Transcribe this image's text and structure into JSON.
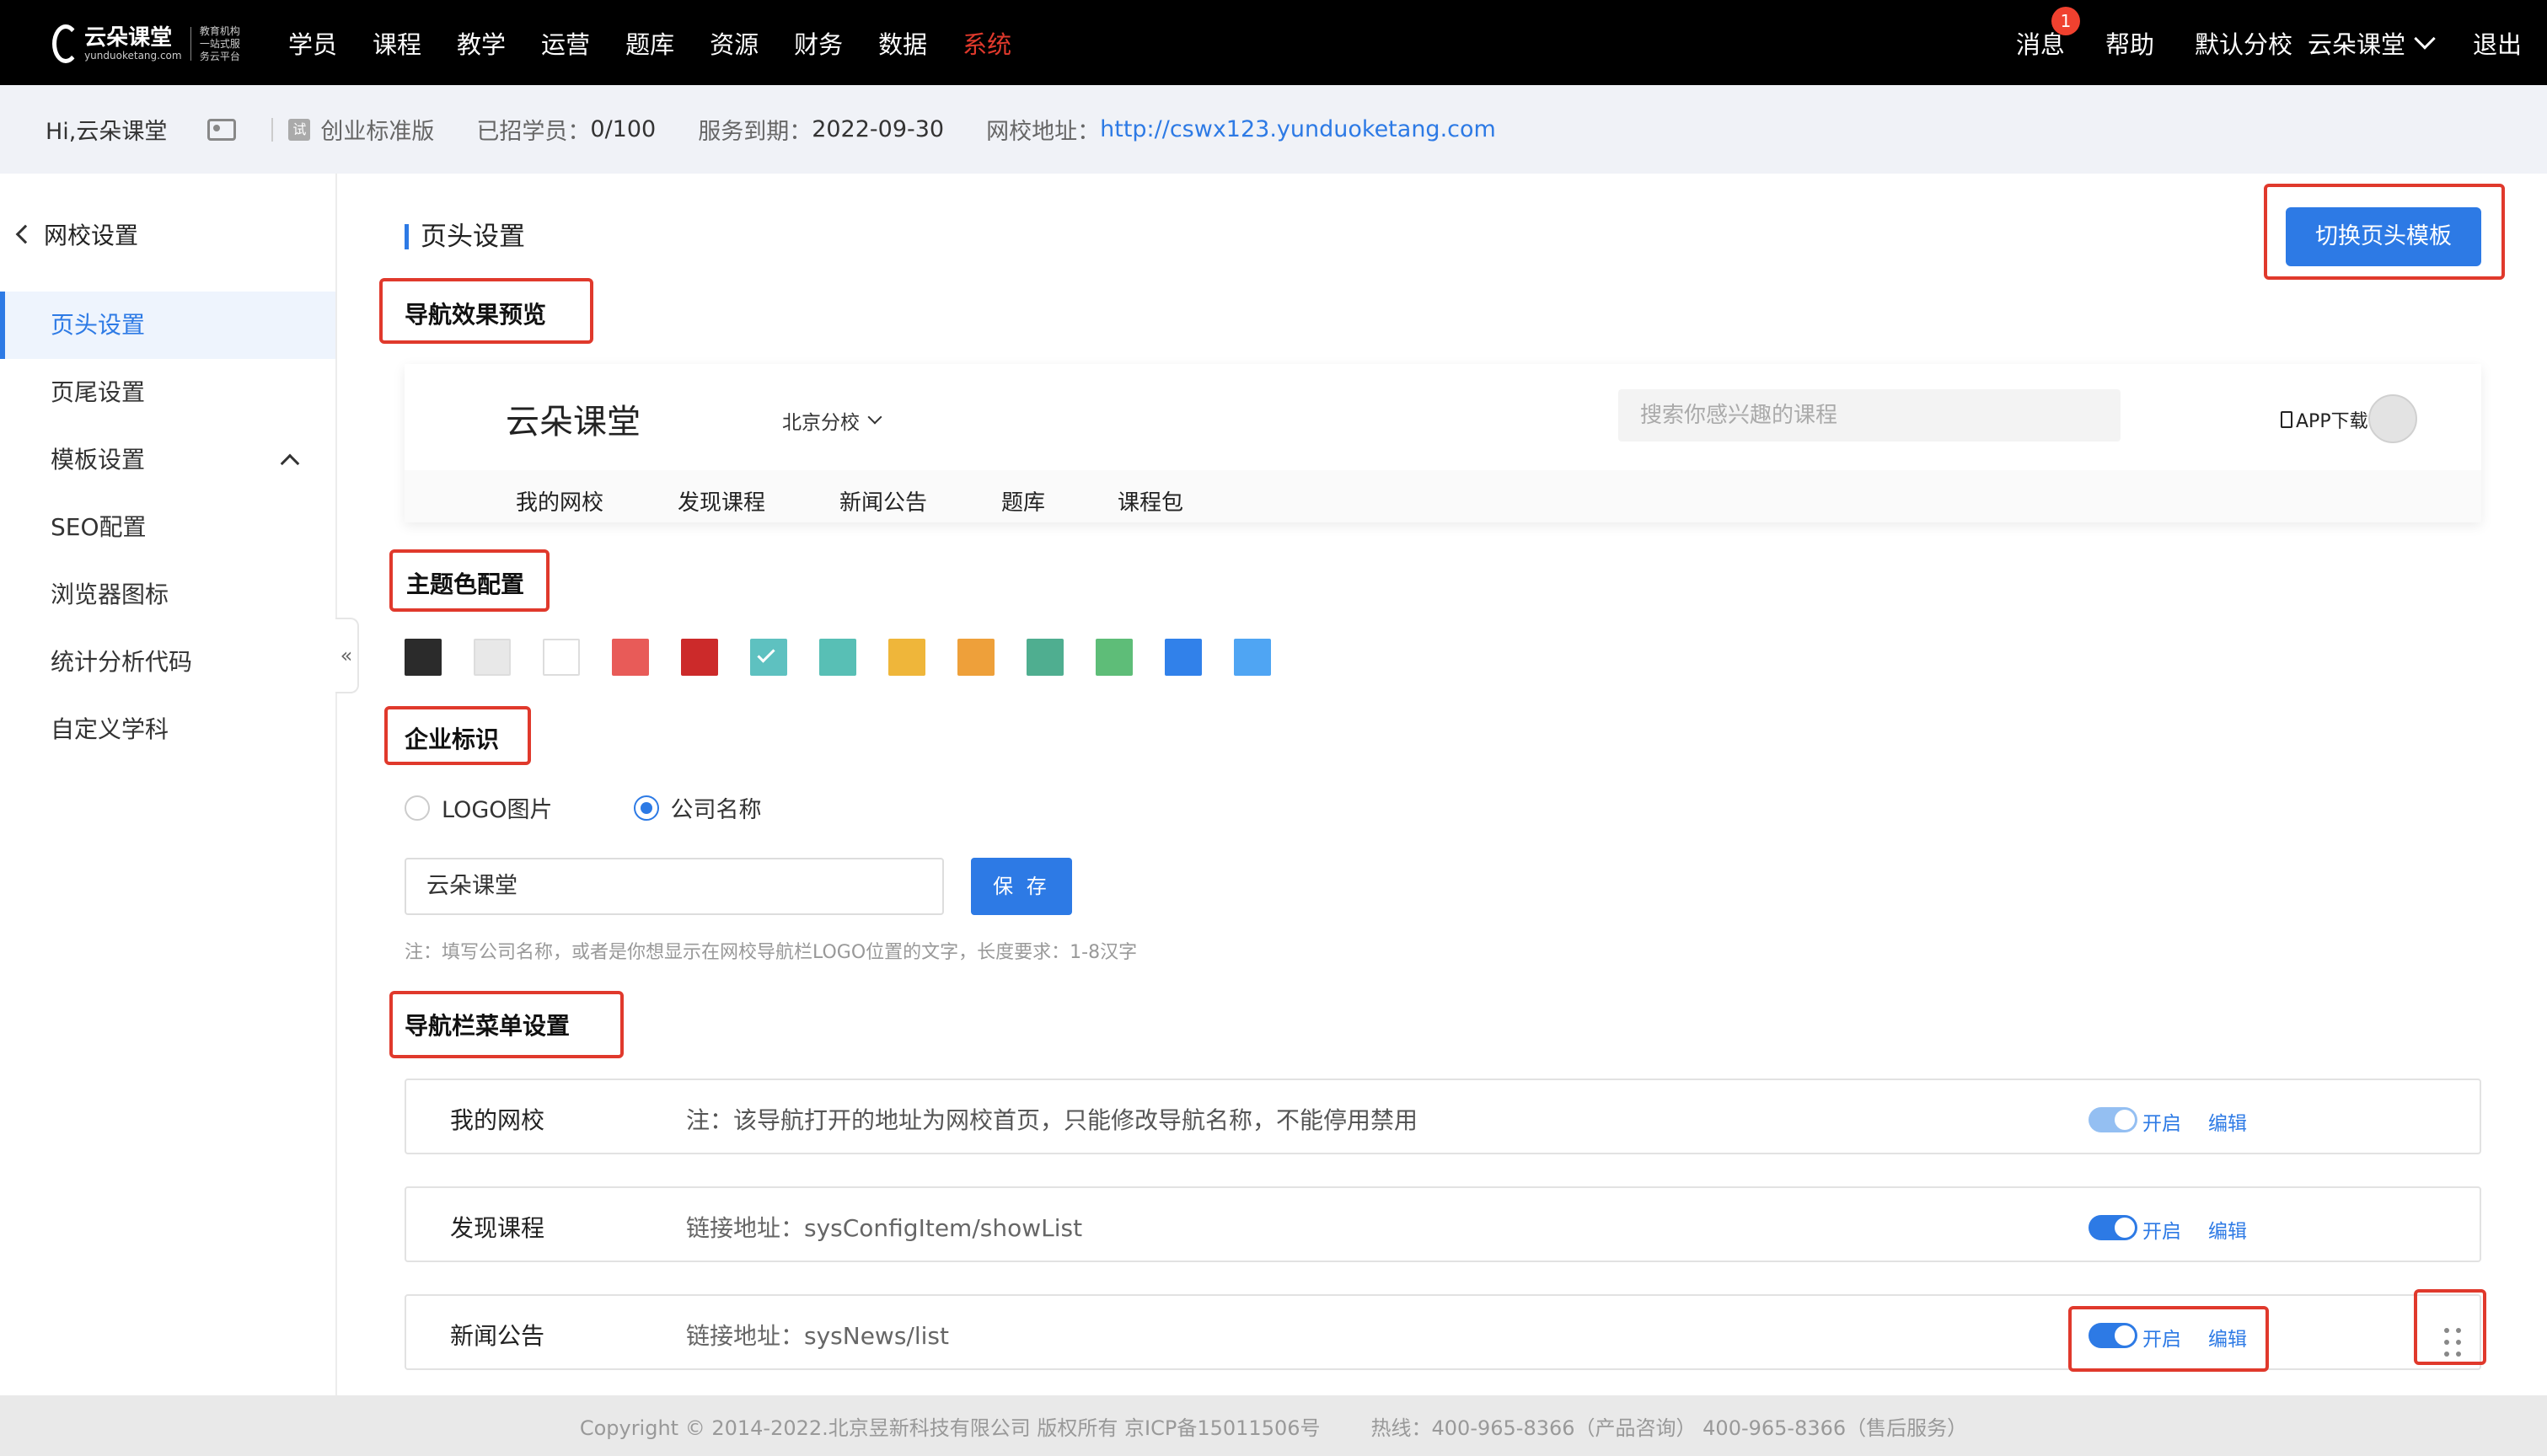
{
  "topbar": {
    "logo_main": "云朵课堂",
    "logo_sub": "yunduoketang.com",
    "logo_slogan": "教育机构一站式服务云平台",
    "nav": [
      "学员",
      "课程",
      "教学",
      "运营",
      "题库",
      "资源",
      "财务",
      "数据",
      "系统"
    ],
    "active_nav": "系统",
    "messages_label": "消息",
    "messages_badge": "1",
    "help_label": "帮助",
    "default_branch": "默认分校",
    "school_name": "云朵课堂",
    "logout_label": "退出",
    "accent_color": "#e0392c"
  },
  "infobar": {
    "greeting": "Hi,云朵课堂",
    "trial_tag": "试",
    "edition": "创业标准版",
    "students_label": "已招学员：",
    "students_value": "0/100",
    "expiry_label": "服务到期：",
    "expiry_value": "2022-09-30",
    "url_label": "网校地址：",
    "url_value": "http://cswx123.yunduoketang.com"
  },
  "sidebar": {
    "title": "网校设置",
    "items": [
      {
        "label": "页头设置",
        "active": true
      },
      {
        "label": "页尾设置"
      },
      {
        "label": "模板设置",
        "expanded": true
      },
      {
        "label": "SEO配置"
      },
      {
        "label": "浏览器图标"
      },
      {
        "label": "统计分析代码"
      },
      {
        "label": "自定义学科"
      }
    ],
    "collapse_glyph": "«"
  },
  "main": {
    "page_title": "页头设置",
    "switch_template_button": "切换页头模板",
    "sections": {
      "preview": "导航效果预览",
      "theme": "主题色配置",
      "brand": "企业标识",
      "nav_menu": "导航栏菜单设置"
    },
    "preview": {
      "brand": "云朵课堂",
      "branch": "北京分校",
      "search_placeholder": "搜索你感兴趣的课程",
      "app_download": "APP下载",
      "nav": [
        "我的网校",
        "发现课程",
        "新闻公告",
        "题库",
        "课程包"
      ]
    },
    "theme_colors": [
      {
        "color": "#2b2b2b"
      },
      {
        "color": "#e8e8e8"
      },
      {
        "color": "#ffffff"
      },
      {
        "color": "#e85b58"
      },
      {
        "color": "#cc2a2a"
      },
      {
        "color": "#5ec1c0",
        "selected": true
      },
      {
        "color": "#58bfb5"
      },
      {
        "color": "#efb63a"
      },
      {
        "color": "#eea03a"
      },
      {
        "color": "#4fae90"
      },
      {
        "color": "#5ebd78"
      },
      {
        "color": "#3181ea"
      },
      {
        "color": "#4fa5f3"
      }
    ],
    "brand_options": [
      {
        "label": "LOGO图片",
        "selected": false
      },
      {
        "label": "公司名称",
        "selected": true
      }
    ],
    "company_name_value": "云朵课堂",
    "save_button": "保 存",
    "note": "注：填写公司名称，或者是你想显示在网校导航栏LOGO位置的文字，长度要求：1-8汉字",
    "menu_rows": [
      {
        "name": "我的网校",
        "desc": "注：该导航打开的地址为网校首页，只能修改导航名称，不能停用禁用",
        "toggle": "开启",
        "edit": "编辑",
        "disabled": true
      },
      {
        "name": "发现课程",
        "desc": "链接地址：sysConfigItem/showList",
        "toggle": "开启",
        "edit": "编辑"
      },
      {
        "name": "新闻公告",
        "desc": "链接地址：sysNews/list",
        "toggle": "开启",
        "edit": "编辑"
      }
    ]
  },
  "footer": {
    "copyright": "Copyright © 2014-2022.北京昱新科技有限公司 版权所有 京ICP备15011506号",
    "hotline": "热线：400-965-8366（产品咨询） 400-965-8366（售后服务）"
  }
}
